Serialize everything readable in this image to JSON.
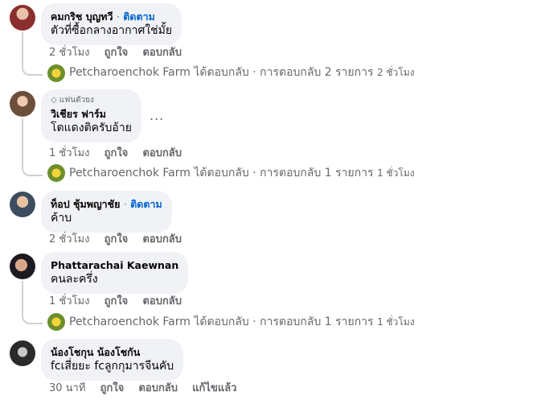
{
  "comments": [
    {
      "name": "คมกริช บุญทวี",
      "follow": "ติดตาม",
      "text": "ตัวที่ซื้อกลางอากาศใช่มั้ย",
      "time": "2 ชั่วโมง",
      "like": "ถูกใจ",
      "reply": "ตอบกลับ",
      "reply_summary": {
        "page": "Petcharoenchok Farm",
        "action": "ได้ตอบกลับ",
        "count": "การตอบกลับ 2 รายการ",
        "time": "2 ชั่วโมง"
      }
    },
    {
      "badge": "แฟนตัวยง",
      "name": "วิเชียร ฟาร์ม",
      "text": "โตแดงติครับอ้าย",
      "time": "1 ชั่วโมง",
      "like": "ถูกใจ",
      "reply": "ตอบกลับ",
      "more": "...",
      "reply_summary": {
        "page": "Petcharoenchok Farm",
        "action": "ได้ตอบกลับ",
        "count": "การตอบกลับ 1 รายการ",
        "time": "1 ชั่วโมง"
      }
    },
    {
      "name": "ท็อป ชุ้มพญาชัย",
      "follow": "ติดตาม",
      "text": "ค้าบ",
      "time": "2 ชั่วโมง",
      "like": "ถูกใจ",
      "reply": "ตอบกลับ"
    },
    {
      "name": "Phattarachai Kaewnan",
      "text": "คนละครึ่ง",
      "time": "1 ชั่วโมง",
      "like": "ถูกใจ",
      "reply": "ตอบกลับ",
      "reply_summary": {
        "page": "Petcharoenchok Farm",
        "action": "ได้ตอบกลับ",
        "count": "การตอบกลับ 1 รายการ",
        "time": "1 ชั่วโมง"
      }
    },
    {
      "name": "น้องโชกุน น้องโชกัน",
      "text": "fcเสี่ยยะ fcลูกกุมารจีนคับ",
      "time": "30 นาที",
      "like": "ถูกใจ",
      "reply": "ตอบกลับ",
      "edited": "แก้ไขแล้ว"
    }
  ],
  "separator": "·"
}
